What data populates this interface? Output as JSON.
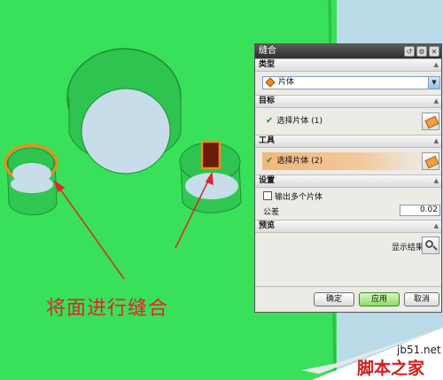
{
  "dialog": {
    "title": "缝合",
    "title_buttons": [
      "reset-icon",
      "gear-icon",
      "close-icon"
    ],
    "sections": {
      "type": {
        "header": "类型",
        "selected": "片体"
      },
      "target": {
        "header": "目标",
        "select_label": "选择片体 (1)"
      },
      "tool": {
        "header": "工具",
        "select_label": "选择片体 (2)"
      },
      "settings": {
        "header": "设置",
        "output_multiple_label": "输出多个片体",
        "output_multiple_checked": false,
        "tolerance_label": "公差",
        "tolerance_value": "0.02"
      },
      "preview": {
        "header": "预览",
        "show_result_label": "显示结果"
      }
    },
    "buttons": {
      "ok": "确定",
      "apply": "应用",
      "cancel": "取消"
    }
  },
  "annotation": {
    "caption": "将面进行缝合"
  },
  "watermark": {
    "site": "jb51.net",
    "name": "脚本之家"
  },
  "colors": {
    "model_green": "#39e05a",
    "arrow_red": "#e0242a",
    "highlight_orange": "#f08a1c"
  }
}
